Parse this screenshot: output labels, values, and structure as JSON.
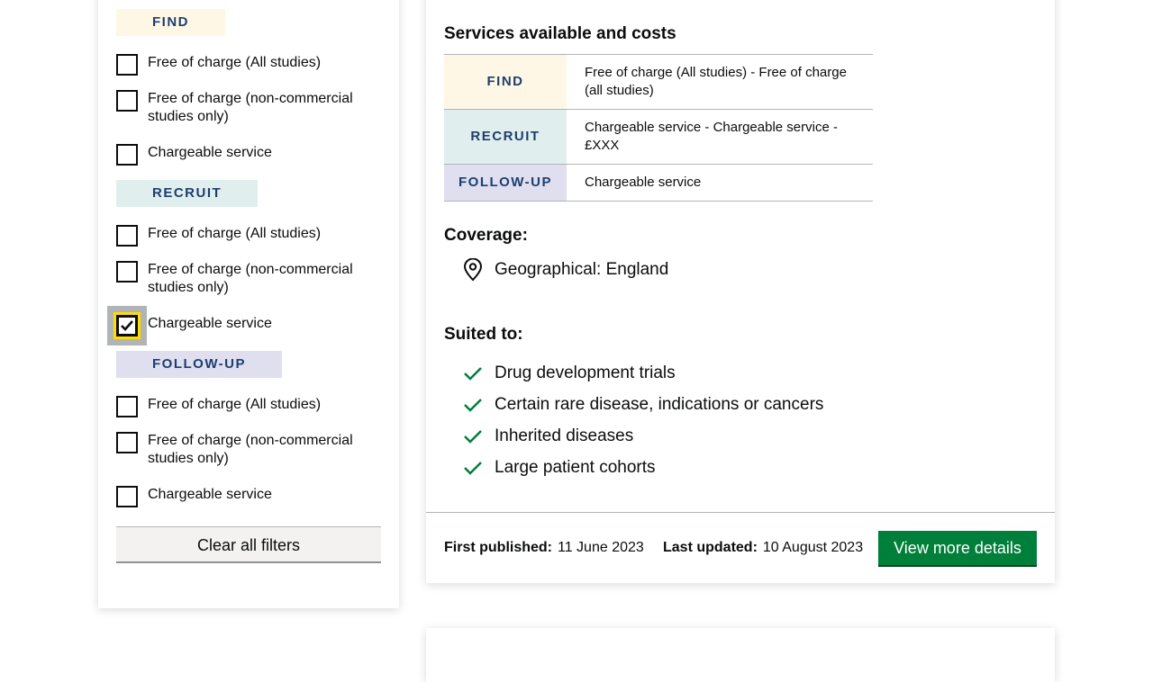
{
  "filters": {
    "find": {
      "tag": "FIND",
      "options": [
        {
          "label": "Free of charge (All studies)",
          "checked": false
        },
        {
          "label": "Free of charge (non-commercial studies only)",
          "checked": false
        },
        {
          "label": "Chargeable service",
          "checked": false
        }
      ]
    },
    "recruit": {
      "tag": "RECRUIT",
      "options": [
        {
          "label": "Free of charge (All studies)",
          "checked": false
        },
        {
          "label": "Free of charge (non-commercial studies only)",
          "checked": false
        },
        {
          "label": "Chargeable service",
          "checked": true
        }
      ]
    },
    "follow_up": {
      "tag": "FOLLOW-UP",
      "options": [
        {
          "label": "Free of charge (All studies)",
          "checked": false
        },
        {
          "label": "Free of charge (non-commercial studies only)",
          "checked": false
        },
        {
          "label": "Chargeable service",
          "checked": false
        }
      ]
    },
    "clear_label": "Clear all filters"
  },
  "card": {
    "services_heading": "Services available and costs",
    "services": [
      {
        "tag": "FIND",
        "value": "Free of charge (All studies) - Free of charge (all studies)"
      },
      {
        "tag": "RECRUIT",
        "value": "Chargeable service - Chargeable service - £XXX"
      },
      {
        "tag": "FOLLOW-UP",
        "value": "Chargeable service"
      }
    ],
    "coverage_heading": "Coverage:",
    "coverage_value": "Geographical: England",
    "suited_heading": "Suited to:",
    "suited": [
      "Drug development trials",
      "Certain rare disease, indications or cancers",
      "Inherited diseases",
      "Large patient cohorts"
    ],
    "first_published_label": "First published:",
    "first_published_value": "11 June 2023",
    "last_updated_label": "Last updated:",
    "last_updated_value": "10 August 2023",
    "view_button": "View more details"
  },
  "colors": {
    "find": "#fff7e6",
    "recruit": "#e0eeee",
    "follow_up": "#dfdff0",
    "tag_text": "#1d3f6e",
    "primary_button": "#007f3b",
    "check": "#007f3b",
    "focus": "#ffdd00"
  }
}
